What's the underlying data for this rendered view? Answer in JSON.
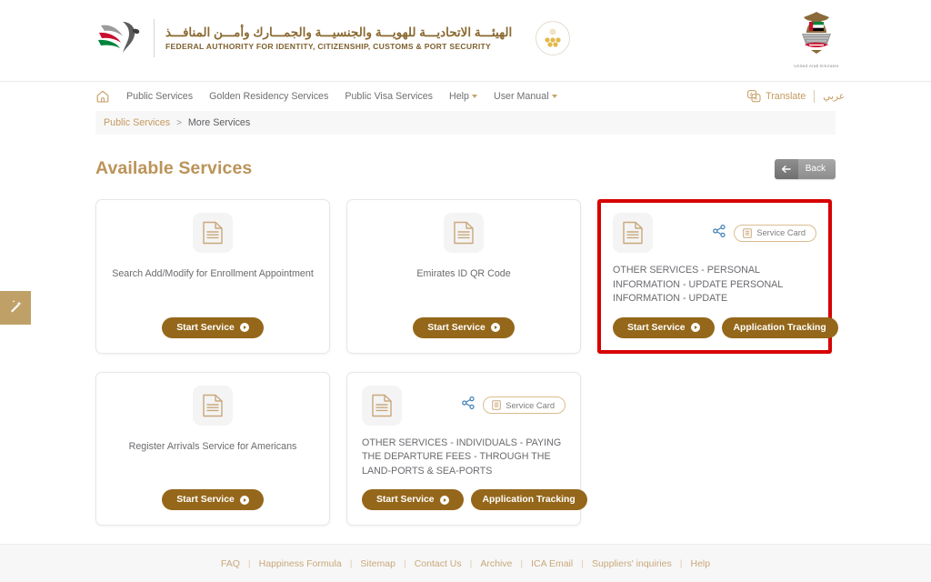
{
  "header": {
    "brand_arabic": "الهيئـــة الاتحاديـــة للهويـــة والجنسيـــة والجمـــارك وأمـــن المنافـــذ",
    "brand_english": "FEDERAL AUTHORITY FOR IDENTITY, CITIZENSHIP, CUSTOMS & PORT SECURITY",
    "emblem_caption": "United Arab Emirates",
    "logo_icon": "falcon-logo-icon",
    "seal_icon": "certification-seal-icon"
  },
  "nav": {
    "home_icon": "home-icon",
    "items": [
      {
        "label": "Public Services",
        "has_caret": false
      },
      {
        "label": "Golden Residency Services",
        "has_caret": false
      },
      {
        "label": "Public Visa Services",
        "has_caret": false
      },
      {
        "label": "Help",
        "has_caret": true
      },
      {
        "label": "User Manual",
        "has_caret": true
      }
    ],
    "translate_label": "Translate",
    "translate_icon": "translate-icon",
    "arabic_label": "عربي"
  },
  "breadcrumb": {
    "parent": "Public Services",
    "separator": ">",
    "current": "More Services"
  },
  "main": {
    "title": "Available Services",
    "back_label": "Back",
    "back_icon": "arrow-left-icon"
  },
  "side_tab": {
    "icon": "magic-wand-icon"
  },
  "colors": {
    "gold_button": "#94671a",
    "title_gold": "#bb9358",
    "link_gold": "#c49a5f",
    "highlight_red": "#d60000",
    "share_blue": "#3d7fb5",
    "pill_border": "#dcbd90",
    "side_tab": "#bfa168"
  },
  "labels": {
    "start_service": "Start Service",
    "application_tracking": "Application Tracking",
    "service_card": "Service Card",
    "doc_icon": "document-icon",
    "share_icon": "share-icon",
    "service_card_icon": "service-card-icon"
  },
  "cards": [
    {
      "id": "search-add-modify-enrollment-appointment",
      "layout": "simple",
      "highlighted": false,
      "title": "Search Add/Modify for Enrollment Appointment",
      "has_share": false,
      "has_service_card": false,
      "has_tracking": false
    },
    {
      "id": "emirates-id-qr-code",
      "layout": "simple",
      "highlighted": false,
      "title": "Emirates ID QR Code",
      "has_share": false,
      "has_service_card": false,
      "has_tracking": false
    },
    {
      "id": "other-services-personal-information-update",
      "layout": "wide",
      "highlighted": true,
      "title": "OTHER SERVICES - PERSONAL INFORMATION - UPDATE PERSONAL INFORMATION - UPDATE",
      "has_share": true,
      "has_service_card": true,
      "has_tracking": true
    },
    {
      "id": "register-arrivals-service-for-americans",
      "layout": "simple",
      "highlighted": false,
      "title": "Register Arrivals Service for Americans",
      "has_share": false,
      "has_service_card": false,
      "has_tracking": false
    },
    {
      "id": "other-services-individuals-departure-fees",
      "layout": "wide",
      "highlighted": false,
      "title": "OTHER SERVICES - INDIVIDUALS - PAYING THE DEPARTURE FEES - THROUGH THE LAND-PORTS & SEA-PORTS",
      "has_share": true,
      "has_service_card": true,
      "has_tracking": true
    }
  ],
  "footer": {
    "links": [
      "FAQ",
      "Happiness Formula",
      "Sitemap",
      "Contact Us",
      "Archive",
      "ICA Email",
      "Suppliers' inquiries",
      "Help"
    ],
    "separator": "|"
  }
}
